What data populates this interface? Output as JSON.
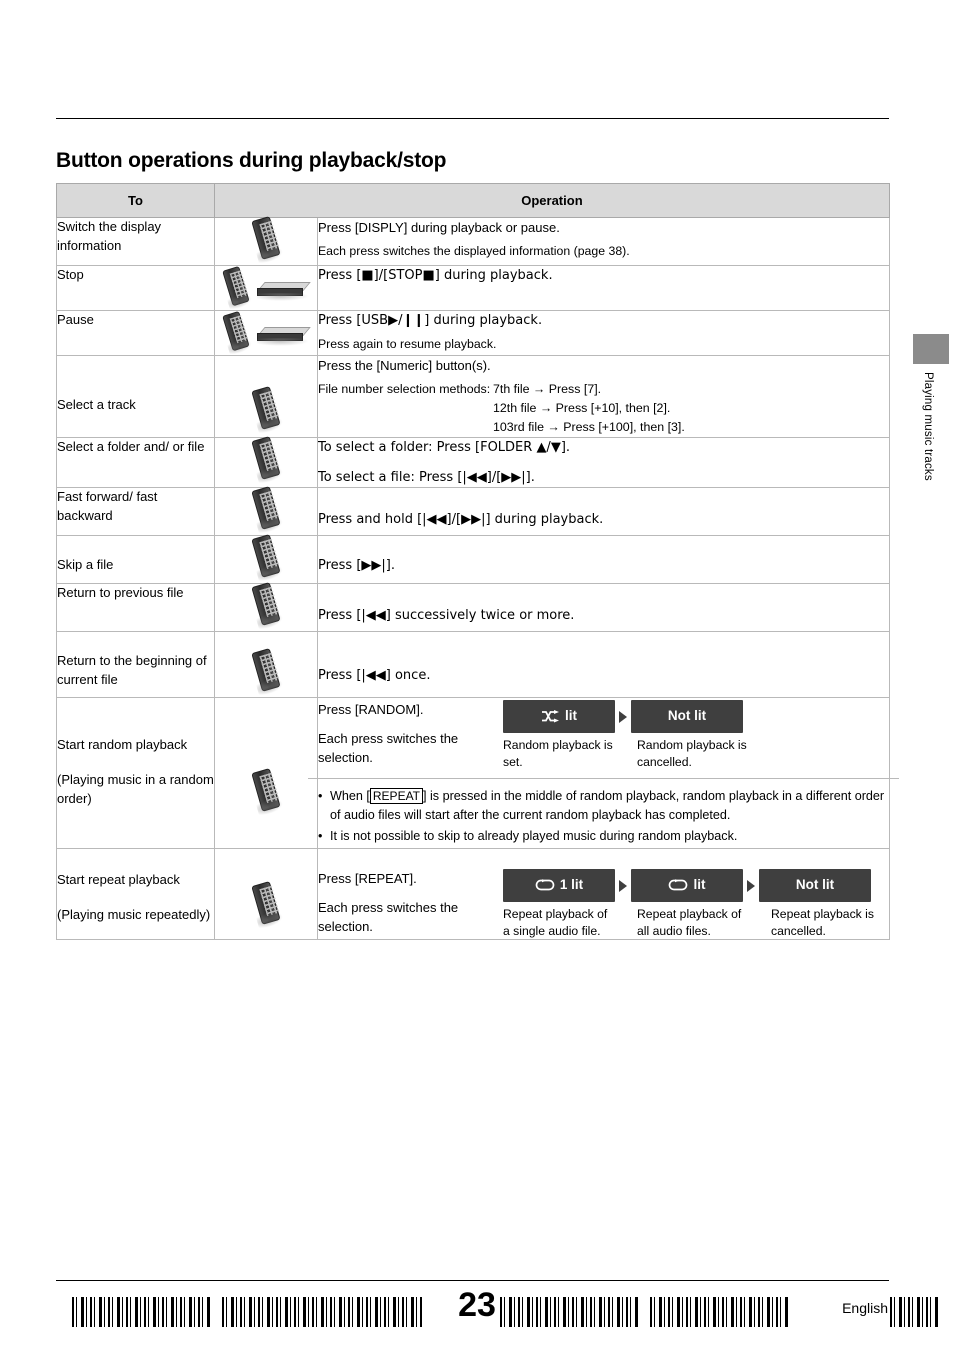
{
  "page": {
    "title": "Button operations during playback/stop",
    "side_label": "Playing music tracks",
    "page_number": "23",
    "language": "English"
  },
  "table": {
    "headers": {
      "to": "To",
      "operation": "Operation"
    },
    "rows": [
      {
        "to": "Switch the display information",
        "icon": "remote-control-icon",
        "lines": [
          "Press [DISPLY] during playback or pause.",
          "Each press switches the displayed information (page 38)."
        ]
      },
      {
        "to": "Stop",
        "icon": "remote-and-unit-icon",
        "lines": [
          "Press [■]/[STOP■] during playback."
        ]
      },
      {
        "to": "Pause",
        "icon": "remote-and-unit-icon",
        "lines": [
          "Press [USB▶/❙❙] during playback.",
          "Press again to resume playback."
        ]
      },
      {
        "to": "Select a track",
        "icon": "remote-control-icon",
        "lines": [
          "Press the [Numeric] button(s)."
        ],
        "methods_label": "File number selection methods:",
        "methods": [
          "7th file → Press [7].",
          "12th file → Press [+10], then [2].",
          "103rd file → Press [+100], then [3]."
        ]
      },
      {
        "to": "Select a folder and/ or file",
        "icon": "remote-control-icon",
        "lines": [
          "To select a folder: Press [FOLDER ▲/▼].",
          "To select a file: Press [|◀◀]/[▶▶|]."
        ]
      },
      {
        "to": "Fast forward/ fast backward",
        "icon": "remote-control-icon",
        "lines": [
          "Press and hold [|◀◀]/[▶▶|] during playback."
        ]
      },
      {
        "to": "Skip a file",
        "icon": "remote-control-icon",
        "lines": [
          "Press [▶▶|]."
        ]
      },
      {
        "to": "Return to previous file",
        "icon": "remote-control-icon",
        "lines": [
          "Press [|◀◀] successively twice or more."
        ]
      },
      {
        "to": "Return to the beginning of current file",
        "icon": "remote-control-icon",
        "lines": [
          "Press [|◀◀] once."
        ]
      }
    ],
    "random_row": {
      "to_line1": "Start random playback",
      "to_line2": "(Playing music in a random order)",
      "icon": "remote-control-icon",
      "press": "Press [RANDOM].",
      "each": "Each press switches the selection.",
      "states": [
        {
          "label": "lit",
          "icon": "shuffle-icon",
          "caption": "Random playback is set."
        },
        {
          "label": "Not lit",
          "icon": "",
          "caption": "Random playback is cancelled."
        }
      ],
      "notes": [
        "When [REPEAT] is pressed in the middle of random playback, random playback in a different order of audio files will start after the current random playback has completed.",
        "It is not possible to skip to already played music during random playback."
      ]
    },
    "repeat_row": {
      "to_line1": "Start repeat playback",
      "to_line2": "(Playing music repeatedly)",
      "icon": "remote-control-icon",
      "press": "Press [REPEAT].",
      "each": "Each press switches the selection.",
      "states": [
        {
          "label": "1 lit",
          "icon": "repeat-icon",
          "caption": "Repeat playback of a single audio file."
        },
        {
          "label": "lit",
          "icon": "repeat-icon",
          "caption": "Repeat playback of all audio files."
        },
        {
          "label": "Not lit",
          "icon": "",
          "caption": "Repeat playback is cancelled."
        }
      ]
    }
  }
}
